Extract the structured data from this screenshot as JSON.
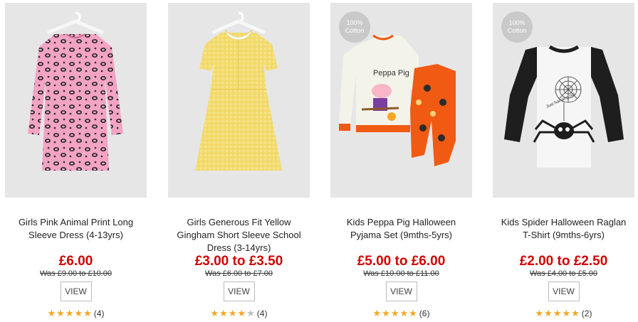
{
  "products": [
    {
      "title": "Girls Pink Animal Print Long Sleeve Dress (4-13yrs)",
      "price": "£6.00",
      "was": "Was £9.00 to £10.00",
      "view_label": "VIEW",
      "rating": 5,
      "reviews": "(4)",
      "badge": null
    },
    {
      "title": "Girls Generous Fit Yellow Gingham Short Sleeve School Dress (3-14yrs)",
      "price": "£3.00 to £3.50",
      "was": "Was £6.00 to £7.00",
      "view_label": "VIEW",
      "rating": 4,
      "reviews": "(4)",
      "badge": null
    },
    {
      "title": "Kids Peppa Pig Halloween Pyjama Set (9mths-5yrs)",
      "price": "£5.00 to £6.00",
      "was": "Was £10.00 to £11.00",
      "view_label": "VIEW",
      "rating": 5,
      "reviews": "(6)",
      "badge": {
        "line1": "100%",
        "line2": "Cotton"
      },
      "image_text": "Peppa Pig"
    },
    {
      "title": "Kids Spider Halloween Raglan T-Shirt (9mths-6yrs)",
      "price": "£2.00 to £2.50",
      "was": "Was £4.00 to £5.00",
      "view_label": "VIEW",
      "rating": 5,
      "reviews": "(2)",
      "badge": {
        "line1": "100%",
        "line2": "Cotton"
      },
      "image_text": "Just hanging out"
    }
  ],
  "colors": {
    "price": "#d40000",
    "star": "#f5a623",
    "star_empty": "#bdbdbd",
    "image_bg": "#e6e6e6"
  }
}
